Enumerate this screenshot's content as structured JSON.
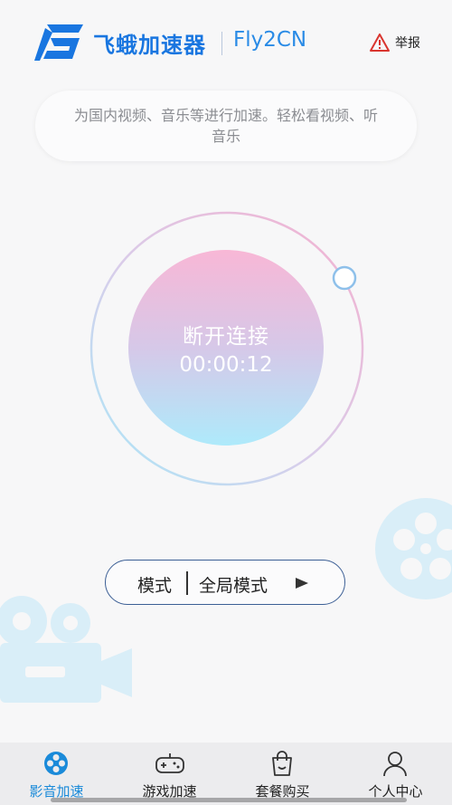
{
  "header": {
    "logo_icon": "fly-logo-icon",
    "title": "飞蛾加速器",
    "subtitle": "Fly2CN",
    "report_icon": "warning-icon",
    "report_label": "举报"
  },
  "banner": {
    "text": "为国内视频、音乐等进行加速。轻松看视频、听音乐"
  },
  "connection": {
    "status_label": "断开连接",
    "timer": "00:00:12"
  },
  "mode": {
    "label": "模式",
    "value": "全局模式",
    "arrow_icon": "play-arrow-icon"
  },
  "tabs": [
    {
      "label": "影音加速",
      "icon": "reel-icon",
      "active": true
    },
    {
      "label": "游戏加速",
      "icon": "gamepad-icon",
      "active": false
    },
    {
      "label": "套餐购买",
      "icon": "shopping-bag-icon",
      "active": false
    },
    {
      "label": "个人中心",
      "icon": "person-icon",
      "active": false
    }
  ],
  "colors": {
    "brand": "#1976e0",
    "accent_tab": "#1a8ad9",
    "circle_top": "#f8b7d6",
    "circle_bottom": "#aeeafb"
  }
}
